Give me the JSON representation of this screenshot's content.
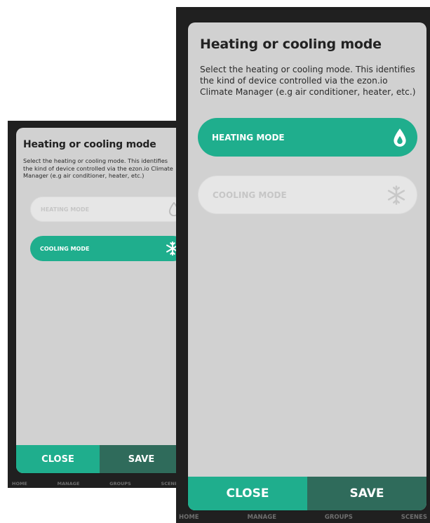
{
  "colors": {
    "accent": "#1fae8d",
    "save_button": "#2f6b5b",
    "dialog_bg": "#d1d1d1",
    "mode_off_bg": "#e6e6e6",
    "mode_off_text": "#c6c6c6",
    "backdrop": "#202020"
  },
  "screens": [
    {
      "dialog": {
        "title": "Heating or cooling mode",
        "description": "Select the heating or cooling mode. This identifies the kind of device controlled via the ezon.io Climate Manager (e.g air conditioner, heater, etc.)",
        "modes": [
          {
            "label": "HEATING MODE",
            "icon": "drop-icon",
            "selected": false
          },
          {
            "label": "COOLING MODE",
            "icon": "snowflake-icon",
            "selected": true
          }
        ],
        "close_label": "CLOSE",
        "save_label": "SAVE"
      },
      "tabbar": [
        "HOME",
        "MANAGE",
        "GROUPS",
        "SCENES"
      ]
    },
    {
      "dialog": {
        "title": "Heating or cooling mode",
        "description": "Select the heating or cooling mode. This identifies the kind of device controlled via the ezon.io Climate Manager (e.g air conditioner, heater, etc.)",
        "modes": [
          {
            "label": "HEATING MODE",
            "icon": "drop-icon",
            "selected": true
          },
          {
            "label": "COOLING MODE",
            "icon": "snowflake-icon",
            "selected": false
          }
        ],
        "close_label": "CLOSE",
        "save_label": "SAVE"
      },
      "tabbar": [
        "HOME",
        "MANAGE",
        "GROUPS",
        "SCENES"
      ]
    }
  ]
}
